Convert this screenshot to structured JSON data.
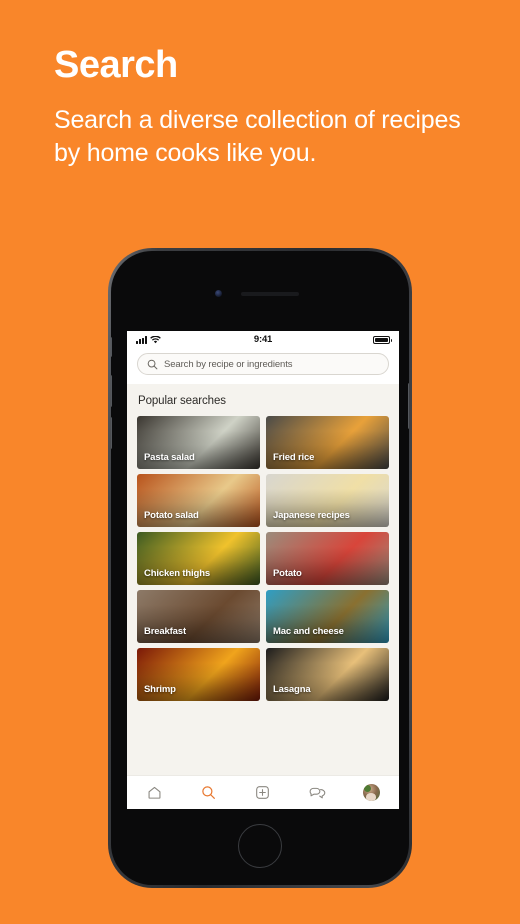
{
  "promo": {
    "title": "Search",
    "subtitle": "Search a diverse collection of recipes by home cooks like you."
  },
  "colors": {
    "background_orange": "#F9862A",
    "accent_orange": "#E8772E",
    "screen_background": "#F5F3EE",
    "text_dark": "#2d2b28"
  },
  "phone": {
    "status_bar": {
      "time": "9:41",
      "signal_icon": "cellular-signal-icon",
      "wifi_icon": "wifi-icon",
      "battery_icon": "battery-full-icon"
    },
    "home_button": "home-button"
  },
  "search": {
    "icon": "search-icon",
    "placeholder": "Search by recipe or ingredients",
    "value": ""
  },
  "main": {
    "section_title": "Popular searches",
    "tiles": [
      {
        "label": "Pasta salad",
        "img_from": "#3a3630",
        "img_to": "#cfd2c6"
      },
      {
        "label": "Fried rice",
        "img_from": "#4a4a48",
        "img_to": "#e8a13a"
      },
      {
        "label": "Potato salad",
        "img_from": "#b8531c",
        "img_to": "#e8c98a"
      },
      {
        "label": "Japanese recipes",
        "img_from": "#d8d6cf",
        "img_to": "#f0dfa6"
      },
      {
        "label": "Chicken thighs",
        "img_from": "#3c5a22",
        "img_to": "#f0c22c"
      },
      {
        "label": "Potato",
        "img_from": "#9a8c7c",
        "img_to": "#d8453a"
      },
      {
        "label": "Breakfast",
        "img_from": "#8d7a68",
        "img_to": "#6b4a30"
      },
      {
        "label": "Mac and cheese",
        "img_from": "#2f9ec4",
        "img_to": "#8a7030"
      },
      {
        "label": "Shrimp",
        "img_from": "#7a1808",
        "img_to": "#f0a41c"
      },
      {
        "label": "Lasagna",
        "img_from": "#1c1c1c",
        "img_to": "#e8c07a"
      }
    ]
  },
  "tabbar": {
    "items": [
      {
        "name": "home",
        "icon": "home-icon",
        "active": false
      },
      {
        "name": "search",
        "icon": "search-icon",
        "active": true
      },
      {
        "name": "create",
        "icon": "plus-square-icon",
        "active": false
      },
      {
        "name": "messages",
        "icon": "chat-bubbles-icon",
        "active": false
      },
      {
        "name": "profile",
        "icon": "avatar-icon",
        "active": false
      }
    ]
  }
}
